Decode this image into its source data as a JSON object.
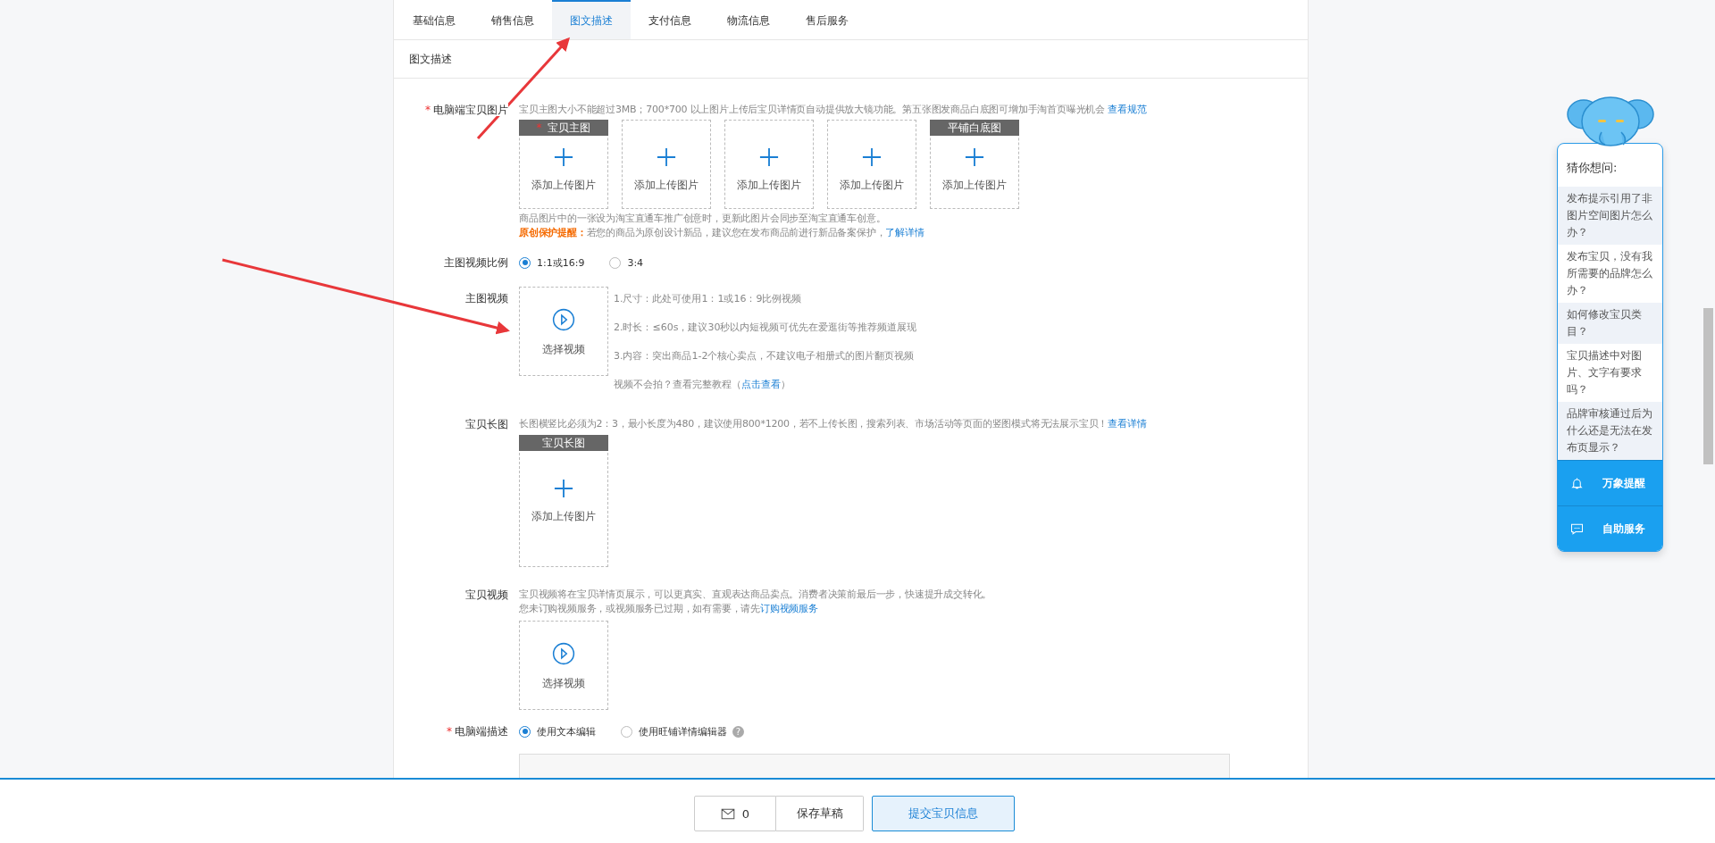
{
  "tabs": [
    {
      "label": "基础信息",
      "selected": false
    },
    {
      "label": "销售信息",
      "selected": false
    },
    {
      "label": "图文描述",
      "selected": true
    },
    {
      "label": "支付信息",
      "selected": false
    },
    {
      "label": "物流信息",
      "selected": false
    },
    {
      "label": "售后服务",
      "selected": false
    }
  ],
  "section_title": "图文描述",
  "main_images": {
    "mark": "*",
    "label": "电脑端宝贝图片",
    "hint": "宝贝主图大小不能超过3MB；700*700 以上图片上传后宝贝详情页自动提供放大镜功能。第五张图发商品白底图可增加手淘首页曝光机会",
    "hint_link": "查看规范",
    "slots": [
      {
        "tag_mark": "*",
        "tag": "宝贝主图",
        "text": "添加上传图片"
      },
      {
        "text": "添加上传图片"
      },
      {
        "text": "添加上传图片"
      },
      {
        "text": "添加上传图片"
      },
      {
        "tag": "平铺白底图",
        "text": "添加上传图片"
      }
    ],
    "note": "商品图片中的一张设为淘宝直通车推广创意时，更新此图片会同步至淘宝直通车创意。",
    "protect_label": "原创保护提醒：",
    "protect_text": "若您的商品为原创设计新品，建议您在发布商品前进行新品备案保护，",
    "protect_link": "了解详情"
  },
  "video_ratio": {
    "label": "主图视频比例",
    "options": [
      {
        "label": "1:1或16:9",
        "selected": true
      },
      {
        "label": "3:4",
        "selected": false
      }
    ]
  },
  "main_video": {
    "label": "主图视频",
    "button": "选择视频",
    "notes": [
      "1.尺寸：此处可使用1：1或16：9比例视频",
      "2.时长：≤60s，建议30秒以内短视频可优先在爱逛街等推荐频道展现",
      "3.内容：突出商品1-2个核心卖点，不建议电子相册式的图片翻页视频"
    ],
    "help": "视频不会拍？查看完整教程（",
    "help_link": "点击查看",
    "help_end": "）"
  },
  "long_image": {
    "label": "宝贝长图",
    "hint": "长图横竖比必须为2：3，最小长度为480，建议使用800*1200，若不上传长图，搜索列表、市场活动等页面的竖图模式将无法展示宝贝！",
    "hint_link": "查看详情",
    "slot": {
      "tag": "宝贝长图",
      "text": "添加上传图片"
    }
  },
  "item_video": {
    "label": "宝贝视频",
    "line1": "宝贝视频将在宝贝详情页展示，可以更真实、直观表达商品卖点。消费者决策前最后一步，快速提升成交转化。",
    "line2": "您未订购视频服务，或视频服务已过期，如有需要，请先",
    "link": "订购视频服务",
    "button": "选择视频"
  },
  "pc_description": {
    "mark": "*",
    "label": "电脑端描述",
    "options": [
      {
        "label": "使用文本编辑",
        "selected": true,
        "help": false
      },
      {
        "label": "使用旺铺详情编辑器",
        "selected": false,
        "help": true
      }
    ],
    "help_icon": "?"
  },
  "footer": {
    "message_count": "0",
    "save": "保存草稿",
    "submit": "提交宝贝信息"
  },
  "assistant": {
    "title": "猜你想问:",
    "questions": [
      "发布提示引用了非图片空间图片怎么办？",
      "发布宝贝，没有我所需要的品牌怎么办？",
      "如何修改宝贝类目？",
      "宝贝描述中对图片、文字有要求吗？",
      "品牌审核通过后为什么还是无法在发布页显示？"
    ],
    "actions": [
      {
        "kind": "bell",
        "label": "万象提醒"
      },
      {
        "kind": "chat",
        "label": "自助服务"
      }
    ]
  }
}
